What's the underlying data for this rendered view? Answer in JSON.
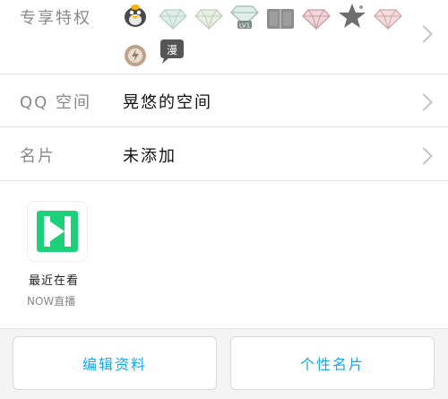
{
  "privileges": {
    "label": "专享特权",
    "badges": [
      {
        "icon": "qq-penguin-icon",
        "text": ""
      },
      {
        "icon": "diamond-icon",
        "text": ""
      },
      {
        "icon": "diamond-icon",
        "text": ""
      },
      {
        "icon": "diamond-lv1-icon",
        "text": "LV1"
      },
      {
        "icon": "book-icon",
        "text": ""
      },
      {
        "icon": "pink-diamond-icon",
        "text": ""
      },
      {
        "icon": "star-icon",
        "text": ""
      },
      {
        "icon": "pink-diamond-icon",
        "text": ""
      },
      {
        "icon": "speed-lightning-icon",
        "text": ""
      },
      {
        "icon": "comic-icon",
        "text": "漫"
      }
    ]
  },
  "qzone": {
    "label": "QQ 空间",
    "value": "晃悠的空间"
  },
  "card": {
    "label": "名片",
    "value": "未添加"
  },
  "recent": {
    "title": "最近在看",
    "app_name": "NOW直播",
    "app_icon": "now-live-icon",
    "app_color": "#1fd07a"
  },
  "footer": {
    "edit_label": "编辑资料",
    "card_label": "个性名片",
    "accent": "#1aa7e8"
  }
}
